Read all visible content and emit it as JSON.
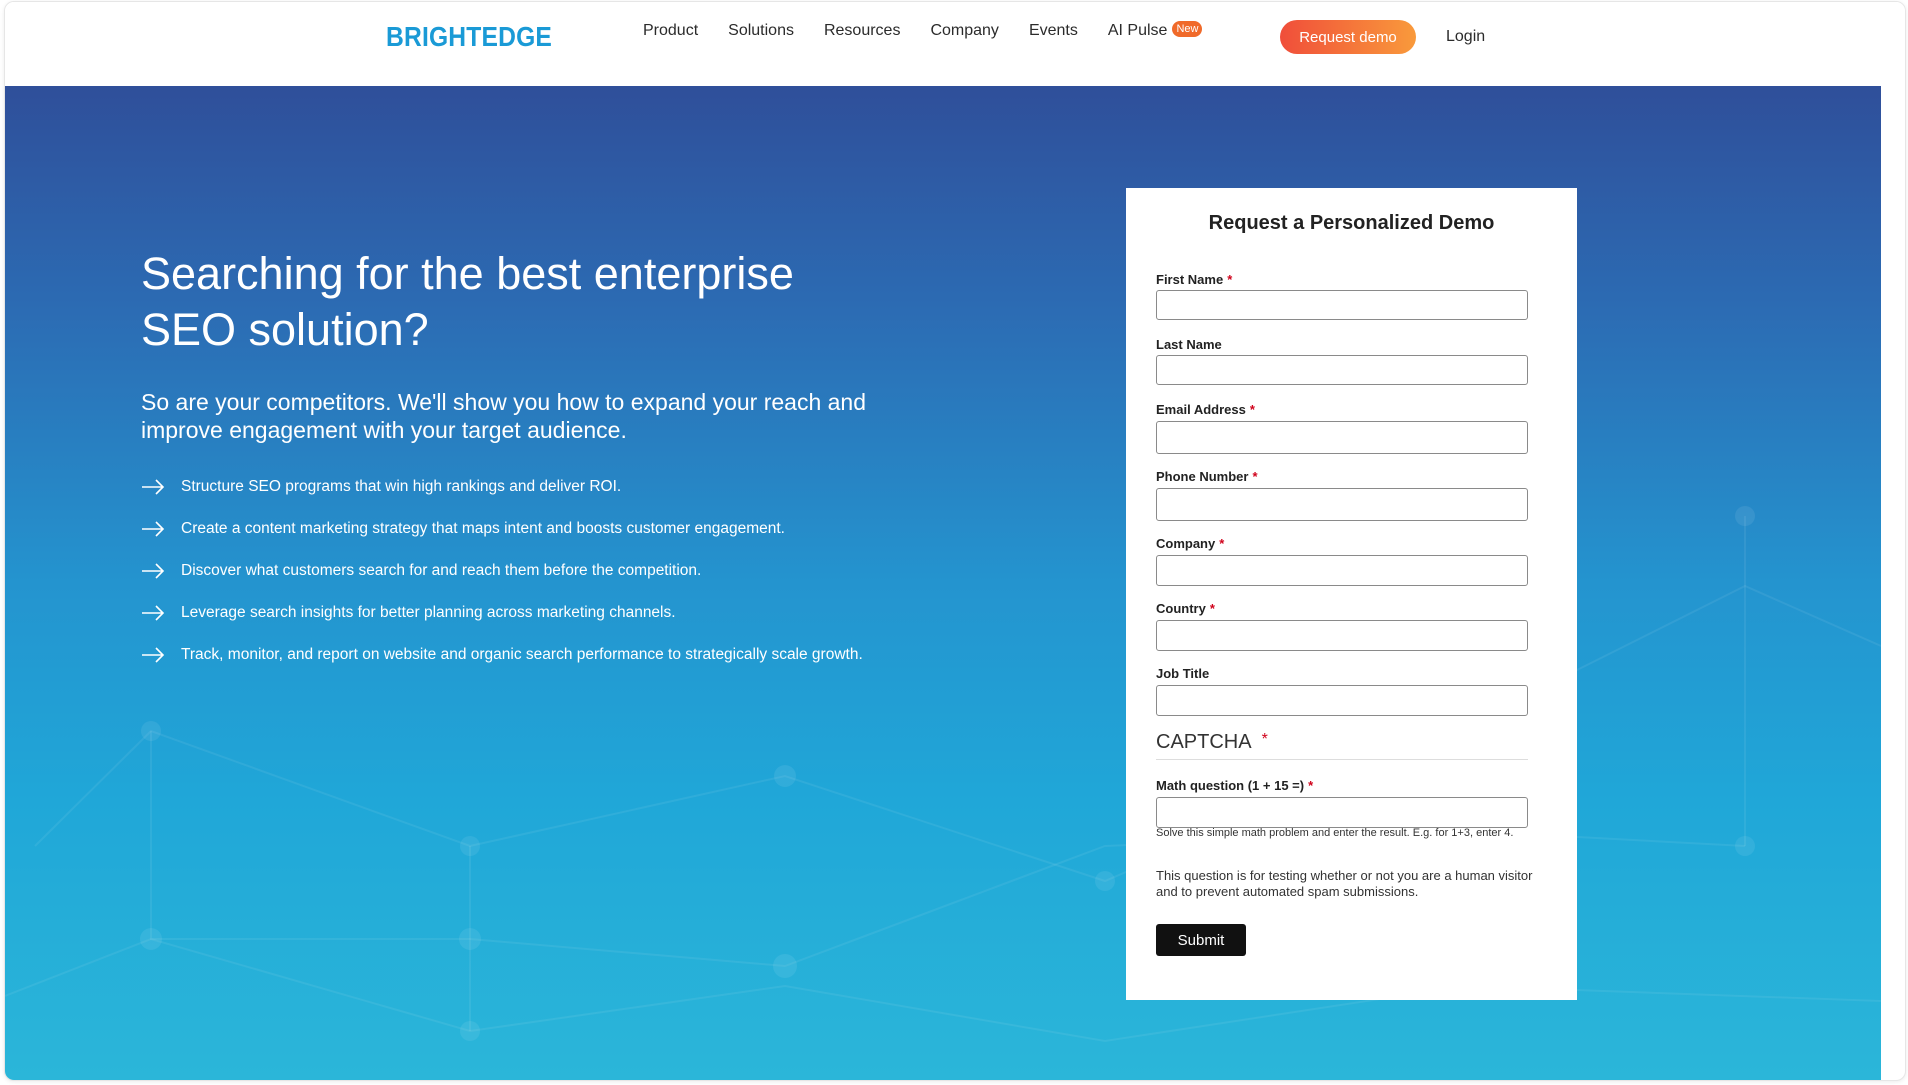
{
  "header": {
    "logo": "BRIGHTEDGE",
    "nav": [
      "Product",
      "Solutions",
      "Resources",
      "Company",
      "Events"
    ],
    "ai_pulse": "AI Pulse",
    "badge": "New",
    "request_demo": "Request demo",
    "login": "Login"
  },
  "hero": {
    "headline_line1": "Searching for the best enterprise",
    "headline_line2": "SEO solution?",
    "subhead": "So are your competitors. We'll show you how to expand your reach and improve engagement with your target audience.",
    "bullets": [
      "Structure SEO programs that win high rankings and deliver ROI.",
      "Create a content marketing strategy that maps intent and boosts customer engagement.",
      "Discover what customers search for and reach them before the competition.",
      "Leverage search insights for better planning across marketing channels.",
      "Track, monitor, and report on website and organic search performance to strategically scale growth."
    ]
  },
  "form": {
    "title": "Request a Personalized Demo",
    "required_mark": "*",
    "fields": {
      "first_name": "First Name",
      "last_name": "Last Name",
      "email": "Email Address",
      "phone": "Phone Number",
      "company": "Company",
      "country": "Country",
      "job_title": "Job Title"
    },
    "captcha": {
      "title": "CAPTCHA",
      "math_label": "Math question (1 + 15 =)",
      "help": "Solve this simple math problem and enter the result. E.g. for 1+3, enter 4.",
      "note": "This question is for testing whether or not you are a human visitor and to prevent automated spam submissions."
    },
    "submit": "Submit"
  }
}
